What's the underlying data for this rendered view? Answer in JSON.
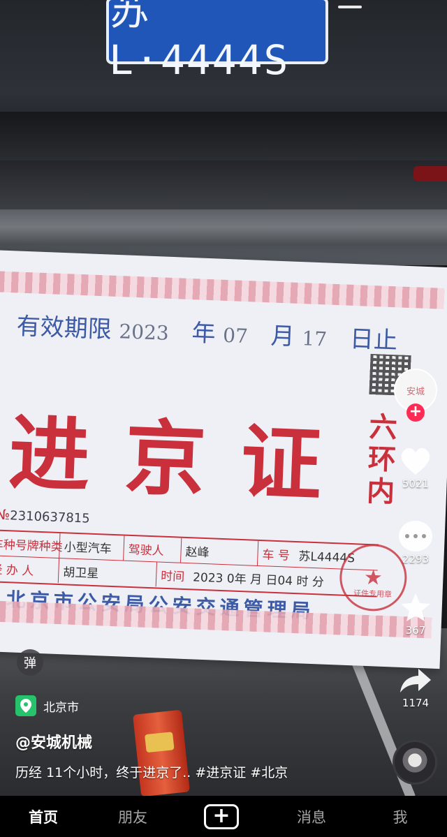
{
  "scene": {
    "license_plate": "苏L·4444S"
  },
  "permit": {
    "validity_label": "有效期限",
    "year_value": "2023",
    "year_unit": "年",
    "month_value": "07",
    "month_unit": "月",
    "day_value": "17",
    "day_unit": "日止",
    "title": "进京证",
    "zone": "六环内",
    "serial_prefix": "№",
    "serial_number": "2310637815",
    "row1": {
      "vehicle_type_label": "车种号牌种类",
      "vehicle_type_value": "小型汽车",
      "driver_label": "驾驶人",
      "driver_value": "赵峰",
      "plate_label": "车 号",
      "plate_value": "苏L4444S"
    },
    "row2": {
      "handler_label": "经 办 人",
      "handler_value": "胡卫星",
      "time_label": "时间",
      "time_value": "2023  0年  月  日04  时  分"
    },
    "authority": "北京市公安局公安交通管理局",
    "stamp_text": "证件专用章"
  },
  "overlay": {
    "creator_avatar_text": "安城",
    "follow_symbol": "+",
    "likes": "5021",
    "comments": "2293",
    "favorites": "367",
    "shares": "1174",
    "danmu_label": "弹",
    "location": "北京市",
    "author": "@安城机械",
    "caption": "历经 11个小时，终于进京了.. #进京证 #北京"
  },
  "tabbar": {
    "home": "首页",
    "friends": "朋友",
    "create": "+",
    "messages": "消息",
    "me": "我"
  },
  "colors": {
    "accent_red": "#fe2c55",
    "permit_red": "#c9303c",
    "permit_blue": "#3c5aa6",
    "location_green": "#27c26c"
  }
}
